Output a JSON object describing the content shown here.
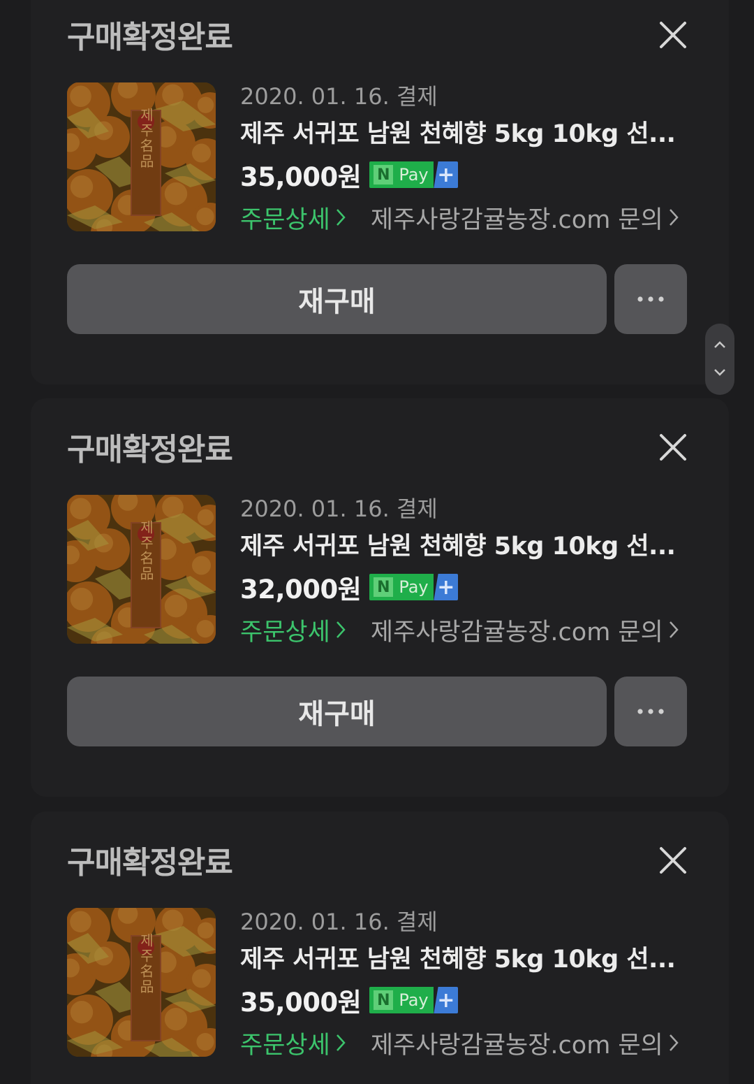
{
  "orders": [
    {
      "status": "구매확정완료",
      "date": "2020. 01. 16. 결제",
      "title": "제주 서귀포 남원 천혜향 5kg 10kg 선...",
      "price": "35,000원",
      "npay_n": "N",
      "npay_pay": "Pay",
      "npay_plus": "+",
      "order_detail": "주문상세",
      "shop_inquiry": "제주사랑감귤농장.com 문의",
      "rebuy": "재구매",
      "more": "···"
    },
    {
      "status": "구매확정완료",
      "date": "2020. 01. 16. 결제",
      "title": "제주 서귀포 남원 천혜향 5kg 10kg 선...",
      "price": "32,000원",
      "npay_n": "N",
      "npay_pay": "Pay",
      "npay_plus": "+",
      "order_detail": "주문상세",
      "shop_inquiry": "제주사랑감귤농장.com 문의",
      "rebuy": "재구매",
      "more": "···"
    },
    {
      "status": "구매확정완료",
      "date": "2020. 01. 16. 결제",
      "title": "제주 서귀포 남원 천혜향 5kg 10kg 선...",
      "price": "35,000원",
      "npay_n": "N",
      "npay_pay": "Pay",
      "npay_plus": "+",
      "order_detail": "주문상세",
      "shop_inquiry": "제주사랑감귤농장.com 문의"
    }
  ],
  "thumbnail_label": "제주名品",
  "colors": {
    "background": "#1c1c1e",
    "card": "#202022",
    "accent_green": "#3cc46c",
    "button": "#555558",
    "npay_green": "#1fae4a",
    "npay_blue": "#3c7bd6"
  },
  "icons": [
    "close-icon",
    "chevron-right-icon",
    "more-dots-icon",
    "chevron-up-icon",
    "chevron-down-icon"
  ]
}
